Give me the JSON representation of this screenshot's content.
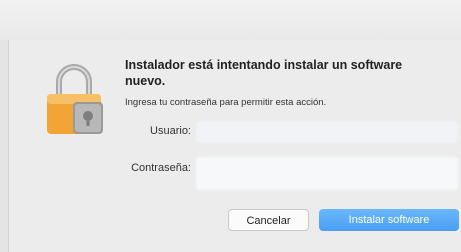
{
  "dialog": {
    "title": "Instalador está intentando instalar un software nuevo.",
    "subtitle": "Ingresa tu contraseña para permitir esta acción.",
    "icon": "lock-icon",
    "fields": {
      "user_label": "Usuario:",
      "user_value": "",
      "password_label": "Contraseña:",
      "password_value": ""
    },
    "buttons": {
      "cancel_label": "Cancelar",
      "install_label": "Instalar software"
    }
  },
  "colors": {
    "accent": "#4a9ef4",
    "lock_body": "#f2a536"
  }
}
